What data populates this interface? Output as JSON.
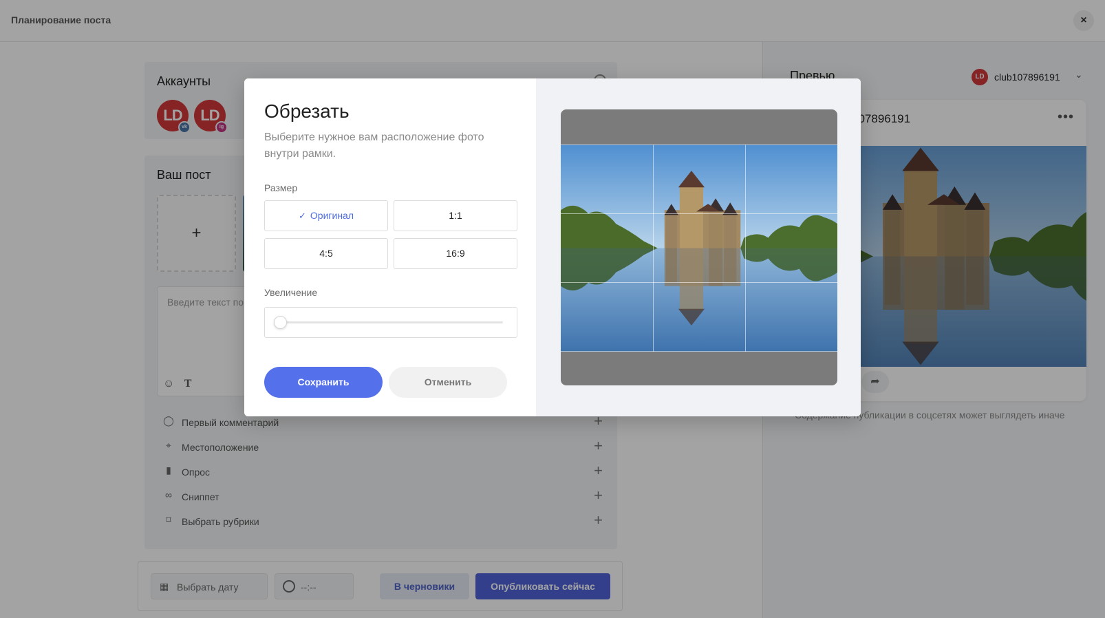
{
  "header": {
    "title": "Планирование поста",
    "close_label": "×"
  },
  "accounts": {
    "heading": "Аккаунты",
    "items": [
      {
        "initials": "LD",
        "network": "vk",
        "badge": "vk"
      },
      {
        "initials": "LD",
        "network": "instagram",
        "badge": "ig"
      }
    ]
  },
  "post": {
    "heading": "Ваш пост",
    "add_label": "+",
    "text_placeholder": "Введите текст по",
    "options": [
      {
        "label": "Первый комментарий",
        "icon": "comment-icon",
        "glyph": "◯"
      },
      {
        "label": "Местоположение",
        "icon": "location-icon",
        "glyph": "⌖"
      },
      {
        "label": "Опрос",
        "icon": "poll-icon",
        "glyph": "▮"
      },
      {
        "label": "Сниппет",
        "icon": "link-icon",
        "glyph": "∞"
      },
      {
        "label": "Выбрать рубрики",
        "icon": "bookmark-icon",
        "glyph": "⌑"
      }
    ],
    "option_add": "+"
  },
  "footer": {
    "date_placeholder": "Выбрать дату",
    "time_placeholder": "--:--",
    "draft_label": "В черновики",
    "publish_label": "Опубликовать сейчас"
  },
  "preview": {
    "title": "Превью",
    "account_name": "club107896191",
    "account_initials": "LD",
    "card_account": "107896191",
    "note": "Содержание публикации в соцсетях может выглядеть иначе"
  },
  "crop_modal": {
    "title": "Обрезать",
    "description": "Выберите нужное вам расположение фото внутри рамки.",
    "size_label": "Размер",
    "sizes": [
      {
        "label": "Оригинал",
        "selected": true
      },
      {
        "label": "1:1",
        "selected": false
      },
      {
        "label": "4:5",
        "selected": false
      },
      {
        "label": "16:9",
        "selected": false
      }
    ],
    "zoom_label": "Увеличение",
    "zoom_value": 0,
    "save_label": "Сохранить",
    "cancel_label": "Отменить"
  },
  "colors": {
    "accent": "#5470ea",
    "publish": "#5063d8",
    "avatar": "#d1373a"
  }
}
